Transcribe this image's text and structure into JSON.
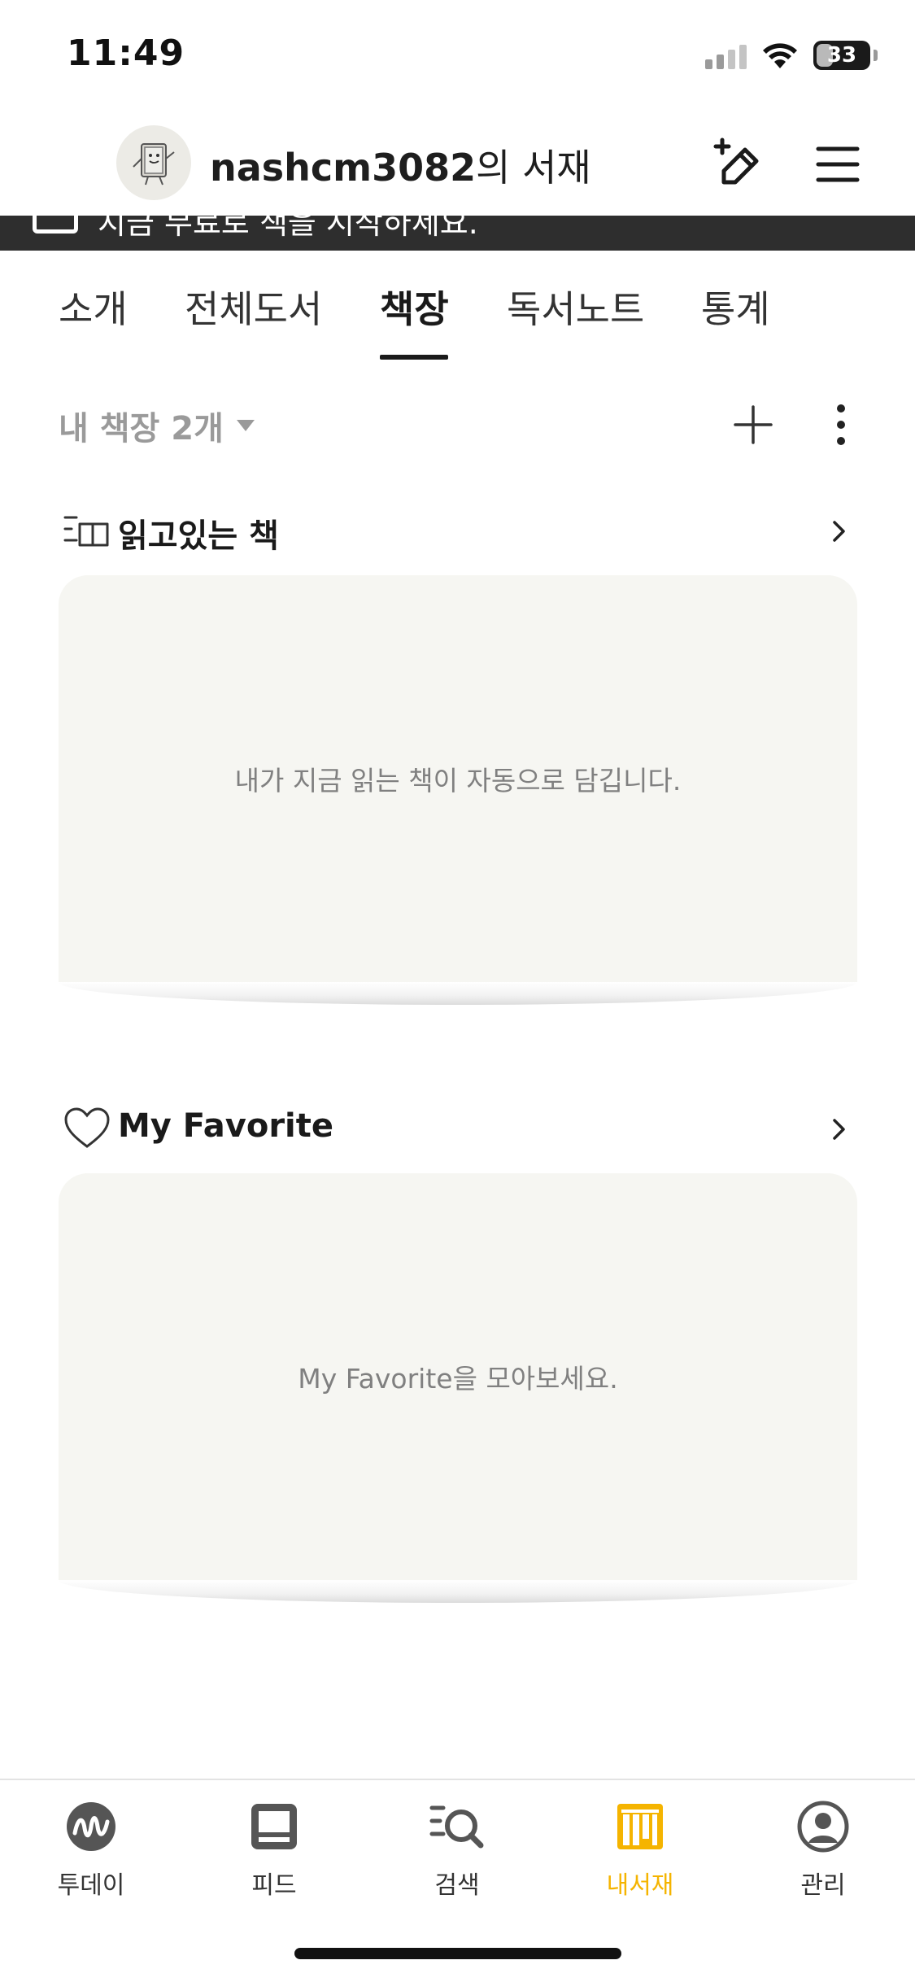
{
  "status_bar": {
    "time": "11:49",
    "battery": "33",
    "battery_level": 0.33
  },
  "header": {
    "username": "nashcm3082",
    "title_suffix": "의 서재",
    "avatar_icon": "book-character-avatar",
    "write_icon": "add-write-icon",
    "menu_icon": "hamburger-menu-icon"
  },
  "notice": {
    "text": "지금 무료로 책을 시작하세요."
  },
  "tabs": [
    {
      "label": "소개",
      "active": false
    },
    {
      "label": "전체도서",
      "active": false
    },
    {
      "label": "책장",
      "active": true
    },
    {
      "label": "독서노트",
      "active": false
    },
    {
      "label": "통계",
      "active": false
    }
  ],
  "shelf_controls": {
    "count_label": "내 책장 2개",
    "add_icon": "plus-icon",
    "more_icon": "more-vertical-icon"
  },
  "shelves": [
    {
      "title": "읽고있는 책",
      "icon": "reading-book-icon",
      "empty_message": "내가 지금 읽는 책이 자동으로 담깁니다."
    },
    {
      "title": "My Favorite",
      "icon": "heart-icon",
      "empty_message": "My Favorite을 모아보세요."
    }
  ],
  "bottom_nav": [
    {
      "label": "투데이",
      "icon": "today-icon",
      "active": false
    },
    {
      "label": "피드",
      "icon": "feed-icon",
      "active": false
    },
    {
      "label": "검색",
      "icon": "search-icon",
      "active": false
    },
    {
      "label": "내서재",
      "icon": "library-icon",
      "active": true
    },
    {
      "label": "관리",
      "icon": "profile-icon",
      "active": false
    }
  ],
  "colors": {
    "accent": "#f5b400",
    "card_bg": "#f6f6f2",
    "notice_bg": "#2e2e2e"
  }
}
